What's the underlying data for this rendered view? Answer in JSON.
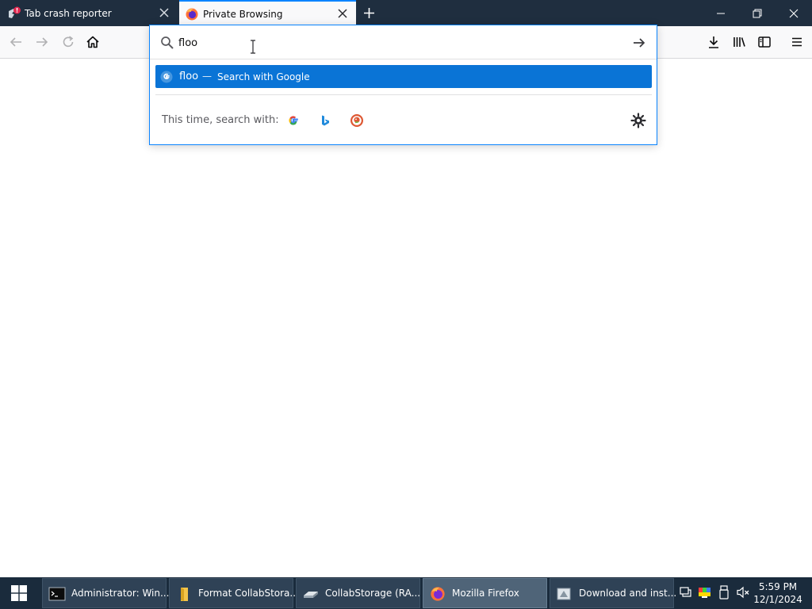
{
  "tabs": [
    {
      "label": "Tab crash reporter",
      "icon": "crash-reporter-icon",
      "active": false
    },
    {
      "label": "Private Browsing",
      "icon": "firefox-logo-icon",
      "active": true
    }
  ],
  "search": {
    "value": "floo",
    "suggestion": {
      "term": "floo",
      "separator": "—",
      "action": "Search with Google"
    },
    "one_off_label": "This time, search with:",
    "engines": [
      "Google",
      "Bing",
      "DuckDuckGo"
    ]
  },
  "taskbar": {
    "items": [
      {
        "label": "Administrator: Win...",
        "icon": "terminal-icon",
        "active": false
      },
      {
        "label": "Format CollabStora...",
        "icon": "folder-icon",
        "active": false
      },
      {
        "label": "CollabStorage (RA...",
        "icon": "drive-icon",
        "active": false
      },
      {
        "label": "Mozilla Firefox",
        "icon": "firefox-icon",
        "active": true
      },
      {
        "label": "Download and inst...",
        "icon": "installer-icon",
        "active": false
      }
    ],
    "time": "5:59 PM",
    "date": "12/1/2024"
  },
  "colors": {
    "accent": "#0a84ff",
    "selection": "#0a74d6",
    "tabstrip": "#1f2e3f",
    "taskbar": "#1a2b3c"
  }
}
